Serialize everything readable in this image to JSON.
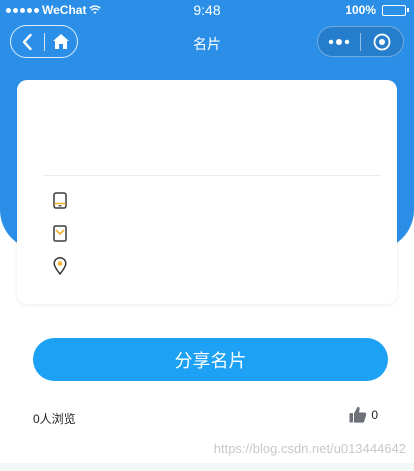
{
  "status_bar": {
    "carrier": "WeChat",
    "time": "9:48",
    "battery": "100%"
  },
  "nav": {
    "title": "名片"
  },
  "card": {
    "rows": [
      {
        "icon": "phone-icon",
        "value": ""
      },
      {
        "icon": "mail-icon",
        "value": ""
      },
      {
        "icon": "location-pin-icon",
        "value": ""
      }
    ]
  },
  "actions": {
    "share_label": "分享名片",
    "views_text": "0人浏览",
    "likes_count": "0"
  },
  "watermark": "https://blog.csdn.net/u013444642",
  "colors": {
    "primary": "#2b8fe8",
    "button": "#1da1f5",
    "icon_accent": "#f5b731"
  }
}
